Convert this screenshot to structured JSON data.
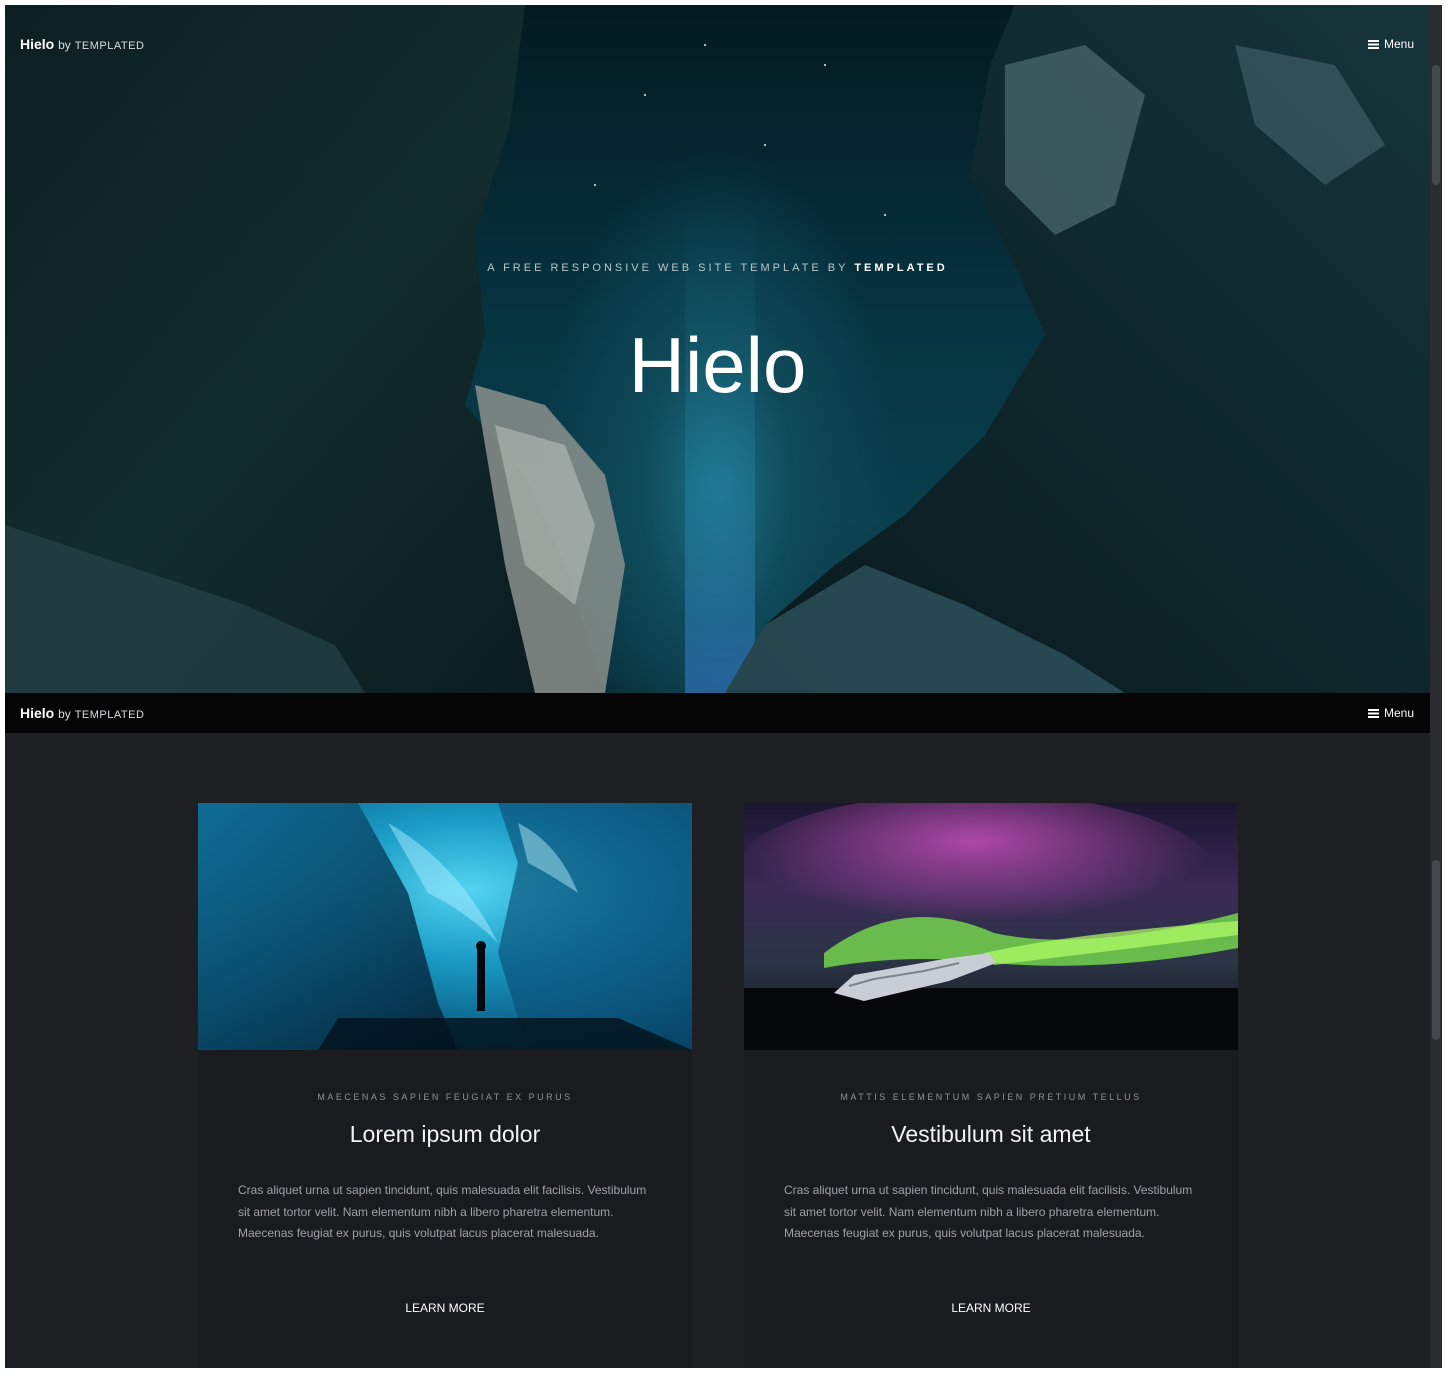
{
  "header": {
    "brand": "Hielo",
    "by": "by",
    "maker": "TEMPLATED",
    "menu_label": "Menu"
  },
  "hero": {
    "subtitle_prefix": "A FREE RESPONSIVE WEB SITE TEMPLATE BY",
    "subtitle_maker": "TEMPLATED",
    "title": "Hielo"
  },
  "cards": [
    {
      "eyebrow": "MAECENAS SAPIEN FEUGIAT EX PURUS",
      "title": "Lorem ipsum dolor",
      "body": "Cras aliquet urna ut sapien tincidunt, quis malesuada elit facilisis. Vestibulum sit amet tortor velit. Nam elementum nibh a libero pharetra elementum. Maecenas feugiat ex purus, quis volutpat lacus placerat malesuada.",
      "cta": "LEARN MORE"
    },
    {
      "eyebrow": "MATTIS ELEMENTUM SAPIEN PRETIUM TELLUS",
      "title": "Vestibulum sit amet",
      "body": "Cras aliquet urna ut sapien tincidunt, quis malesuada elit facilisis. Vestibulum sit amet tortor velit. Nam elementum nibh a libero pharetra elementum. Maecenas feugiat ex purus, quis volutpat lacus placerat malesuada.",
      "cta": "LEARN MORE"
    }
  ],
  "colors": {
    "page_background": "#1d1f22",
    "card_background": "#1a1b1e",
    "nav_background": "#050505",
    "hero_teal": "#0a3f4d"
  }
}
